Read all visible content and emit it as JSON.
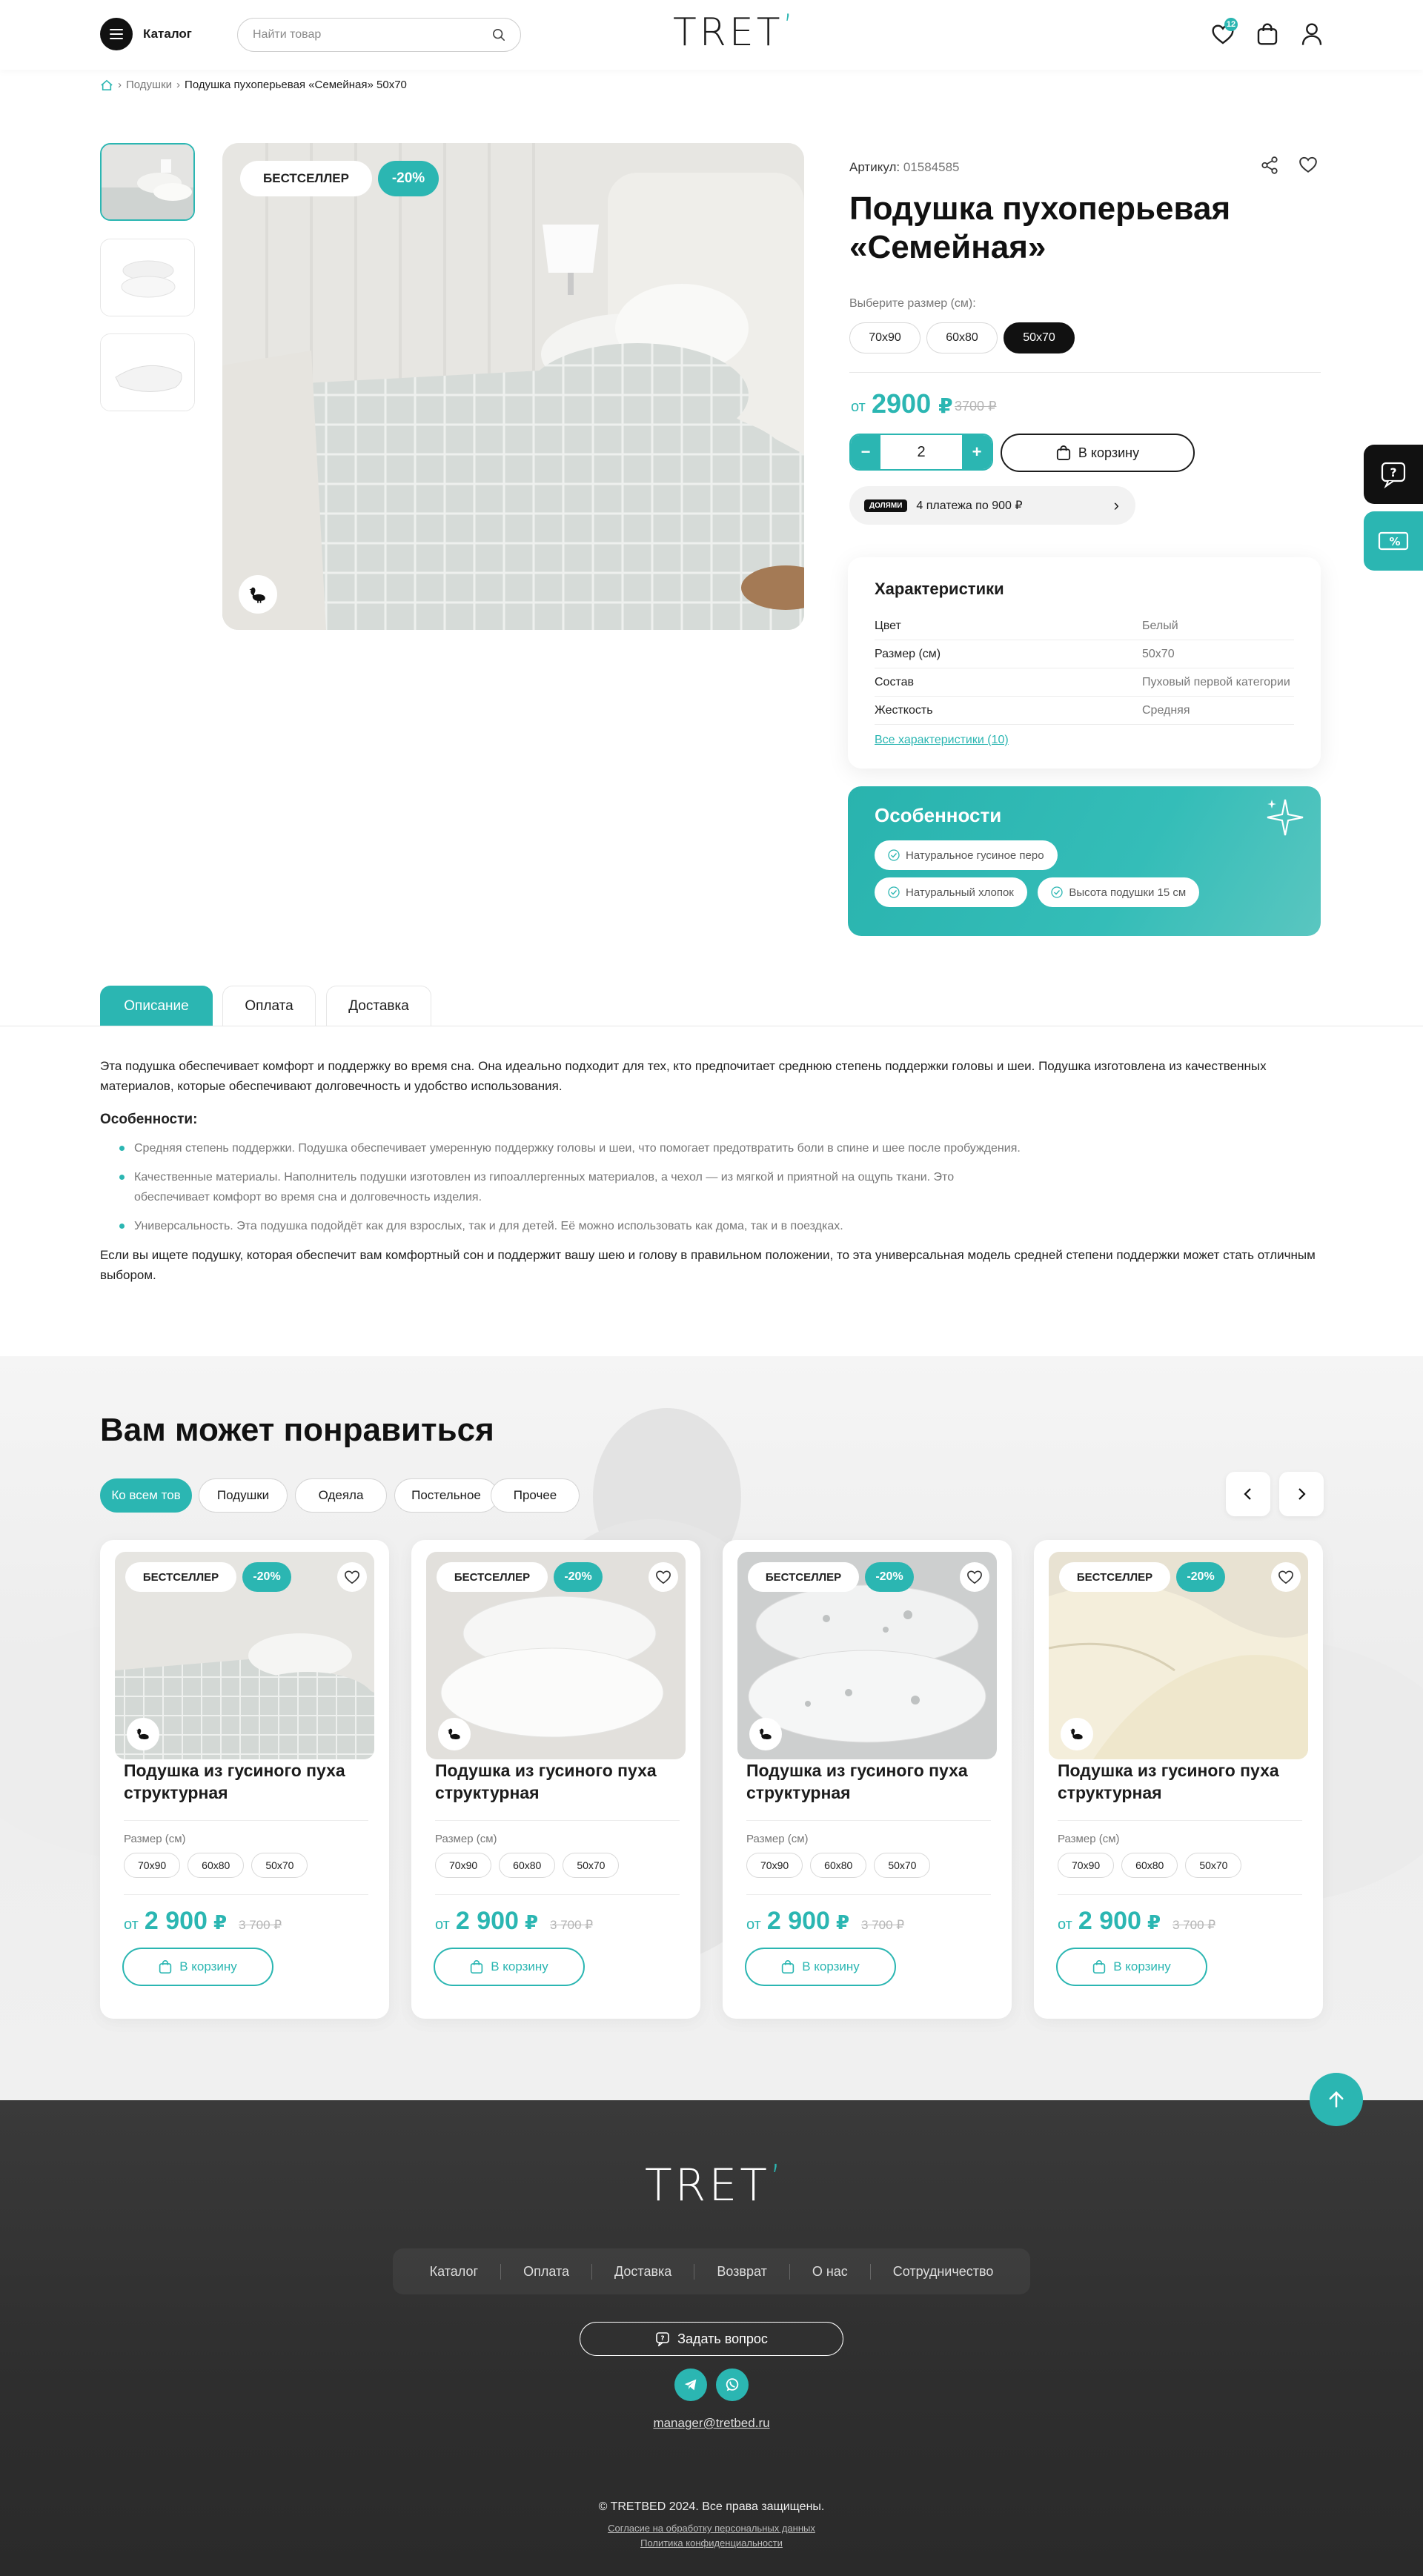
{
  "header": {
    "catalog_label": "Каталог",
    "search_placeholder": "Найти товар",
    "logo": "TRET",
    "logo_accent": "ʼ",
    "favorites_count": "12"
  },
  "breadcrumb": {
    "parent": "Подушки",
    "current": "Подушка пухоперьевая «Семейная» 50х70",
    "separator": "›"
  },
  "product": {
    "badge_label": "БЕСТСЕЛЛЕР",
    "discount": "-20%",
    "article_label": "Артикул:",
    "article_value": "01584585",
    "title": "Подушка пухоперьевая «Семейная»",
    "size_label": "Выберите размер (см):",
    "sizes": [
      "70х90",
      "60х80",
      "50х70"
    ],
    "selected_size": "50х70",
    "price_from": "от",
    "price": "2900",
    "currency": "₽",
    "price_old": "3700 ₽",
    "qty_minus": "−",
    "qty_value": "2",
    "qty_plus": "+",
    "cart_label": "В корзину",
    "dolyame_logo": "ДОЛЯМИ",
    "dolyame_text": "4 платежа по 900 ₽",
    "dolyame_arrow": "›"
  },
  "characteristics": {
    "title": "Характеристики",
    "rows": [
      {
        "key": "Цвет",
        "value": "Белый"
      },
      {
        "key": "Размер (см)",
        "value": "50х70"
      },
      {
        "key": "Состав",
        "value": "Пуховый первой категории"
      },
      {
        "key": "Жесткость",
        "value": "Средняя"
      }
    ],
    "all_link": "Все характеристики (10)"
  },
  "features": {
    "title": "Особенности",
    "chips": [
      "Натуральное гусиное перо",
      "Натуральный хлопок",
      "Высота подушки 15 см"
    ]
  },
  "tabs": [
    "Описание",
    "Оплата",
    "Доставка"
  ],
  "description": {
    "intro": "Эта подушка обеспечивает комфорт и поддержку во время сна. Она идеально подходит для тех, кто предпочитает среднюю степень поддержки головы и шеи. Подушка изготовлена из качественных материалов, которые обеспечивают долговечность и удобство использования.",
    "features_title": "Особенности:",
    "items": [
      "Средняя степень поддержки. Подушка обеспечивает умеренную поддержку головы и шеи, что помогает предотвратить боли в спине и шее после пробуждения.",
      "Качественные материалы. Наполнитель подушки изготовлен из гипоаллергенных материалов, а чехол — из мягкой и приятной на ощупь ткани. Это обеспечивает комфорт во время сна и долговечность изделия.",
      "Универсальность. Эта подушка подойдёт как для взрослых, так и для детей. Её можно использовать как дома, так и в поездках."
    ],
    "outro": "Если вы ищете подушку, которая обеспечит вам комфортный сон и поддержит вашу шею и голову в правильном положении, то эта универсальная модель средней степени поддержки может стать отличным выбором."
  },
  "recommendations": {
    "title": "Вам может понравиться",
    "filters": [
      "Ко всем тов",
      "Подушки",
      "Одеяла",
      "Постельное",
      "Прочее"
    ],
    "cards": [
      {
        "badge": "БЕСТСЕЛЛЕР",
        "discount": "-20%",
        "title": "Подушка из гусиного пуха структурная",
        "size_label": "Размер (см)",
        "sizes": [
          "70х90",
          "60х80",
          "50х70"
        ],
        "price_from": "от",
        "price": "2 900",
        "currency": "₽",
        "price_old": "3 700 ₽",
        "cart": "В корзину"
      },
      {
        "badge": "БЕСТСЕЛЛЕР",
        "discount": "-20%",
        "title": "Подушка из гусиного пуха структурная",
        "size_label": "Размер (см)",
        "sizes": [
          "70х90",
          "60х80",
          "50х70"
        ],
        "price_from": "от",
        "price": "2 900",
        "currency": "₽",
        "price_old": "3 700 ₽",
        "cart": "В корзину"
      },
      {
        "badge": "БЕСТСЕЛЛЕР",
        "discount": "-20%",
        "title": "Подушка из гусиного пуха структурная",
        "size_label": "Размер (см)",
        "sizes": [
          "70х90",
          "60х80",
          "50х70"
        ],
        "price_from": "от",
        "price": "2 900",
        "currency": "₽",
        "price_old": "3 700 ₽",
        "cart": "В корзину"
      },
      {
        "badge": "БЕСТСЕЛЛЕР",
        "discount": "-20%",
        "title": "Подушка из гусиного пуха структурная",
        "size_label": "Размер (см)",
        "sizes": [
          "70х90",
          "60х80",
          "50х70"
        ],
        "price_from": "от",
        "price": "2 900",
        "currency": "₽",
        "price_old": "3 700 ₽",
        "cart": "В корзину"
      }
    ]
  },
  "footer": {
    "logo": "TRET",
    "logo_accent": "ʼ",
    "nav": [
      "Каталог",
      "Оплата",
      "Доставка",
      "Возврат",
      "О нас",
      "Сотрудничество"
    ],
    "ask_label": "Задать вопрос",
    "email": "manager@tretbed.ru",
    "copyright": "© TRETBED 2024. Все права защищены.",
    "consent_link": "Согласие на обработку персональных данных",
    "privacy_link": "Политика конфиденциальности"
  },
  "colors": {
    "accent": "#2bb6b2",
    "dark": "#111111",
    "footer_bg": "#333333"
  }
}
